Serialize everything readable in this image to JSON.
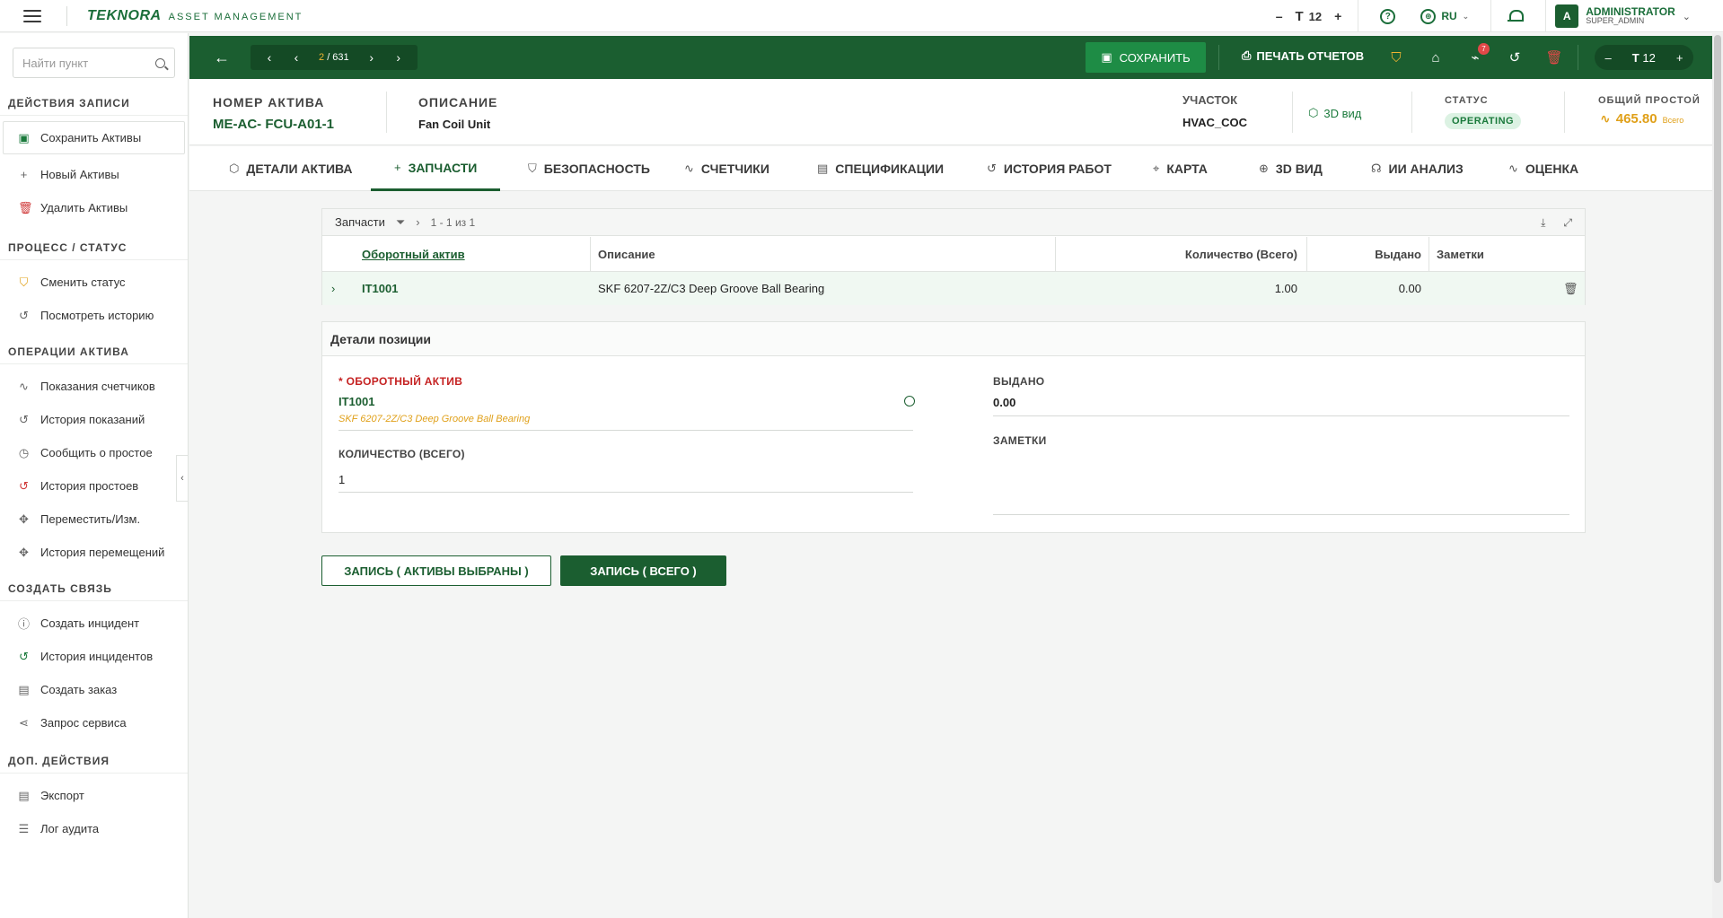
{
  "topbar": {
    "brand_logo": "TEKNORA",
    "brand_sub": "ASSET MANAGEMENT",
    "font_size": "12",
    "lang": "RU",
    "user_initial": "A",
    "user_name": "ADMINISTRATOR",
    "user_role": "SUPER_ADMIN"
  },
  "sidebar": {
    "search_placeholder": "Найти пункт",
    "sections": {
      "record_actions": "ДЕЙСТВИЯ ЗАПИСИ",
      "process_status": "ПРОЦЕСС / СТАТУС",
      "asset_ops": "ОПЕРАЦИИ АКТИВА",
      "create_link": "СОЗДАТЬ СВЯЗЬ",
      "extra": "ДОП. ДЕЙСТВИЯ"
    },
    "items": {
      "save": "Сохранить Активы",
      "new": "Новый Активы",
      "delete": "Удалить Активы",
      "change_status": "Сменить статус",
      "view_history": "Посмотреть историю",
      "meter_readings": "Показания счетчиков",
      "reading_history": "История показаний",
      "report_downtime": "Сообщить о простое",
      "downtime_history": "История простоев",
      "move": "Переместить/Изм.",
      "move_history": "История перемещений",
      "create_incident": "Создать инцидент",
      "incident_history": "История инцидентов",
      "create_order": "Создать заказ",
      "service_request": "Запрос сервиса",
      "export": "Экспорт",
      "audit_log": "Лог аудита"
    }
  },
  "toolbar": {
    "pager_current": "2",
    "pager_total": "/ 631",
    "save_label": "СОХРАНИТЬ",
    "print_label": "ПЕЧАТЬ ОТЧЕТОВ",
    "attachments_badge": "7",
    "zoom_value": "12"
  },
  "header": {
    "asset_no_label": "НОМЕР АКТИВА",
    "asset_no": "ME-AC- FCU-A01-1",
    "desc_label": "ОПИСАНИЕ",
    "desc": "Fan Coil Unit",
    "site_label": "УЧАСТОК",
    "site": "HVAC_COC",
    "view3d": "3D вид",
    "status_label": "СТАТУС",
    "status": "OPERATING",
    "downtime_label": "ОБЩИЙ ПРОСТОЙ",
    "downtime_value": "465.80",
    "downtime_unit": "Всего"
  },
  "tabs": [
    {
      "label": "ДЕТАЛИ АКТИВА"
    },
    {
      "label": "ЗАПЧАСТИ"
    },
    {
      "label": "БЕЗОПАСНОСТЬ"
    },
    {
      "label": "СЧЕТЧИКИ"
    },
    {
      "label": "СПЕЦИФИКАЦИИ"
    },
    {
      "label": "ИСТОРИЯ РАБОТ"
    },
    {
      "label": "КАРТА"
    },
    {
      "label": "3D ВИД"
    },
    {
      "label": "ИИ АНАЛИЗ"
    },
    {
      "label": "ОЦЕНКА"
    }
  ],
  "grid": {
    "title": "Запчасти",
    "count": "1 - 1 из 1",
    "columns": {
      "asset": "Оборотный актив",
      "desc": "Описание",
      "qty": "Количество (Всего)",
      "issued": "Выдано",
      "notes": "Заметки"
    },
    "rows": [
      {
        "asset": "IT1001",
        "desc": "SKF 6207-2Z/C3 Deep Groove Ball Bearing",
        "qty": "1.00",
        "issued": "0.00",
        "notes": ""
      }
    ]
  },
  "detail": {
    "title": "Детали позиции",
    "asset_label": "* ОБОРОТНЫЙ АКТИВ",
    "asset_value": "IT1001",
    "asset_desc": "SKF 6207-2Z/C3 Deep Groove Ball Bearing",
    "qty_label": "КОЛИЧЕСТВО (ВСЕГО)",
    "qty_value": "1",
    "issued_label": "ВЫДАНО",
    "issued_value": "0.00",
    "notes_label": "ЗАМЕТКИ",
    "notes_value": ""
  },
  "actions": {
    "save_selected": "ЗАПИСЬ ( АКТИВЫ ВЫБРАНЫ )",
    "save_all": "ЗАПИСЬ ( ВСЕГО )"
  }
}
